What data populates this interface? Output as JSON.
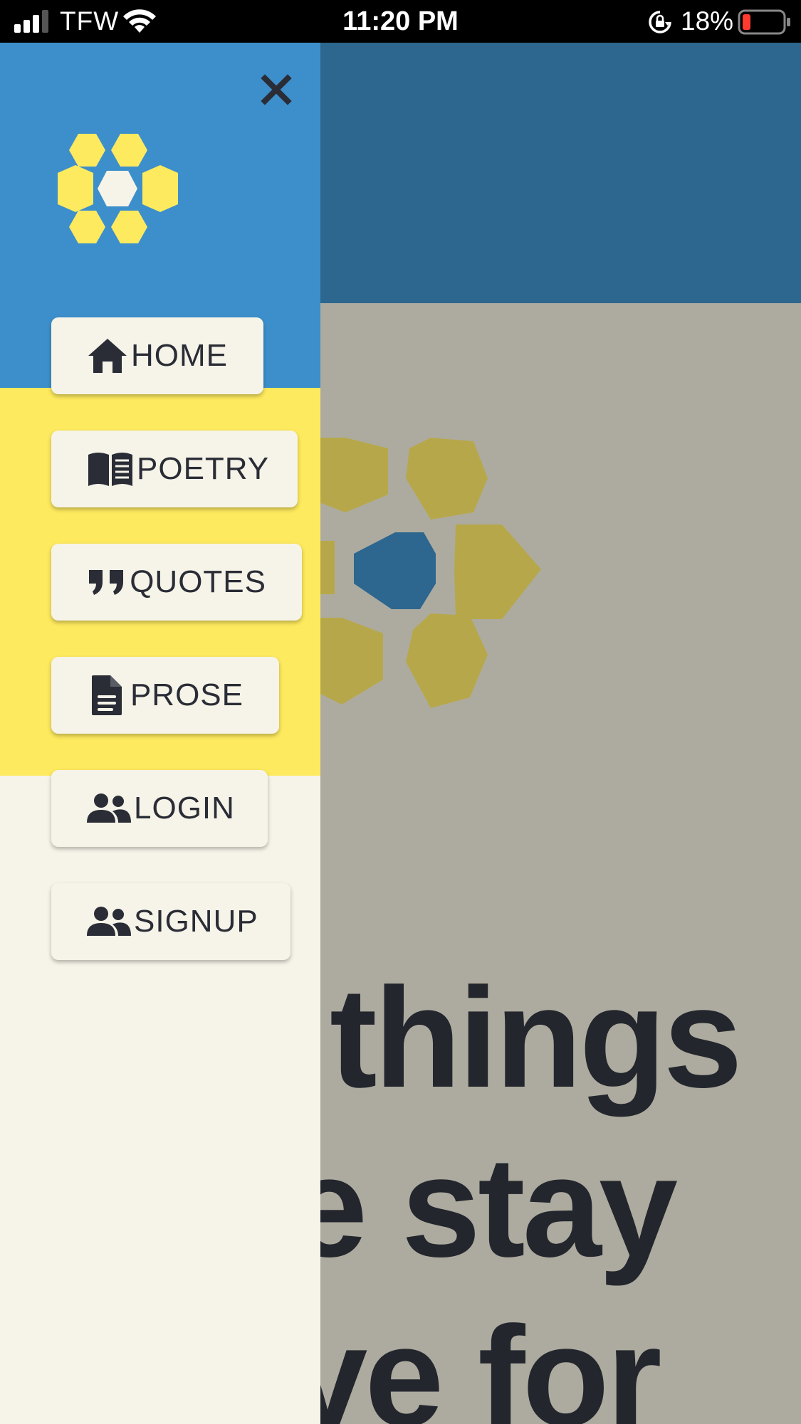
{
  "status_bar": {
    "carrier": "TFW",
    "time": "11:20 PM",
    "battery": "18%"
  },
  "drawer": {
    "close_icon": "close-icon",
    "nav": [
      {
        "label": "HOME",
        "icon": "home-icon"
      },
      {
        "label": "POETRY",
        "icon": "book-icon"
      },
      {
        "label": "QUOTES",
        "icon": "quote-icon"
      },
      {
        "label": "PROSE",
        "icon": "document-icon"
      },
      {
        "label": "LOGIN",
        "icon": "users-icon"
      },
      {
        "label": "SIGNUP",
        "icon": "users-icon"
      }
    ]
  },
  "hero": {
    "lines": [
      "things",
      "e stay",
      "ve for"
    ]
  },
  "colors": {
    "drawer_blue": "#3d8fcb",
    "drawer_yellow": "#feea5e",
    "drawer_cream": "#f6f4e8",
    "header_blue": "#2d668f",
    "hero_gray": "#adab9f",
    "text_dark": "#2a2c36"
  }
}
